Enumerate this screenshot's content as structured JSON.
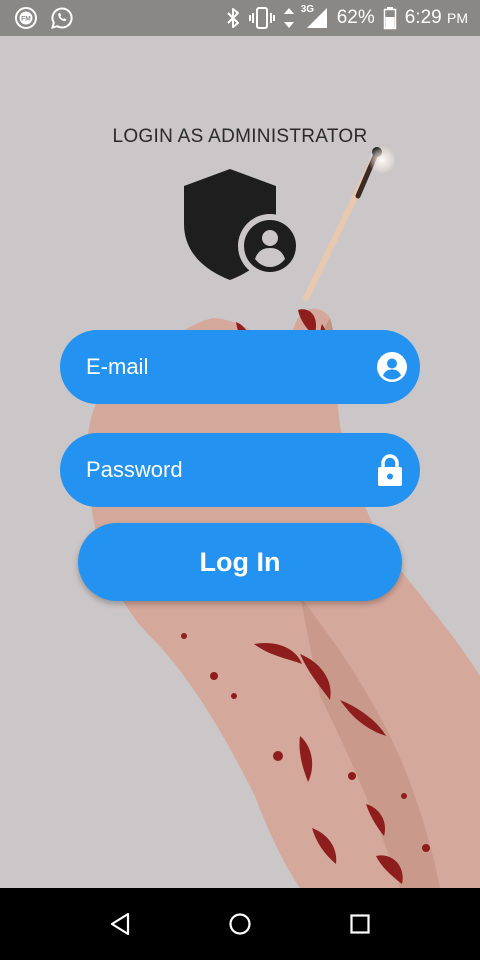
{
  "status_bar": {
    "battery": "62%",
    "time": "6:29",
    "ampm": "PM",
    "network": "3G",
    "icons": [
      "fm-radio-icon",
      "whatsapp-icon",
      "bluetooth-icon",
      "vibrate-icon",
      "data-arrows-icon",
      "signal-icon",
      "battery-icon"
    ]
  },
  "login": {
    "title": "LOGIN AS ADMINISTRATOR",
    "email_placeholder": "E-mail",
    "password_placeholder": "Password",
    "login_label": "Log In",
    "icons": [
      "admin-shield-icon",
      "account-circle-icon",
      "lock-icon"
    ]
  },
  "nav_bar": {
    "icons": [
      "back-icon",
      "home-icon",
      "recents-icon"
    ]
  },
  "colors": {
    "accent": "#2492f0",
    "status_bar": "#8a8787",
    "background": "#cbc6c7",
    "nav_bar": "#000000"
  }
}
